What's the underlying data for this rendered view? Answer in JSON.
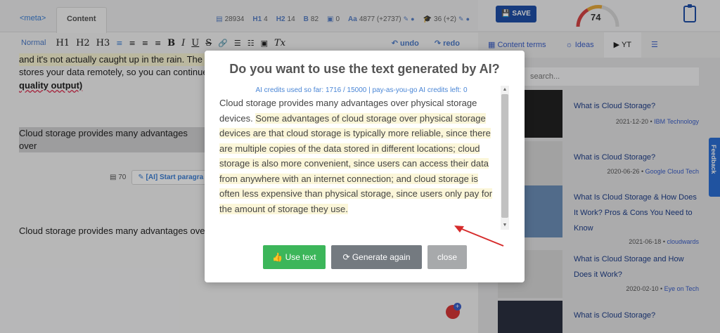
{
  "editor": {
    "tabs": {
      "meta": "<meta>",
      "content": "Content"
    },
    "stats": {
      "words": "28934",
      "h1": "4",
      "h2": "14",
      "bold": "82",
      "images": "0",
      "characters": "4877 (+2737)",
      "readers": "36 (+2)"
    },
    "toolbar": {
      "style": "Normal",
      "h1": "H1",
      "h2": "H2",
      "h3": "H3",
      "undo": "undo",
      "redo": "redo"
    },
    "text": {
      "line1": "and it's not actually caught up in the rain. The v",
      "line2": "stores your data remotely, so you can continue",
      "line3": "quality output)",
      "highlight_line": "Cloud storage provides many advantages over",
      "para_count": "70",
      "ai_button": "[AI] Start paragra",
      "bottom_line": "Cloud storage provides many advantages over"
    }
  },
  "sidebar": {
    "save_label": "SAVE",
    "score": "74",
    "tabs": {
      "content_terms": "Content terms",
      "ideas": "Ideas",
      "yt": "YT"
    },
    "search_placeholder": "search...",
    "videos": [
      {
        "title": "What is Cloud Storage?",
        "date": "2021-12-20",
        "channel": "IBM Technology"
      },
      {
        "title": "What is Cloud Storage?",
        "date": "2020-06-26",
        "channel": "Google Cloud Tech"
      },
      {
        "title": "What Is Cloud Storage & How Does It Work? Pros & Cons You Need to Know",
        "date": "2021-06-18",
        "channel": "cloudwards"
      },
      {
        "title": "What is Cloud Storage and How Does it Work?",
        "date": "2020-02-10",
        "channel": "Eye on Tech"
      },
      {
        "title": "What is Cloud Storage?",
        "date": "",
        "channel": ""
      }
    ],
    "feedback": "Feedback"
  },
  "modal": {
    "title": "Do you want to use the text generated by AI?",
    "credits": "AI credits used so far: 1716 / 15000 | pay-as-you-go AI credits left: 0",
    "original_text": "Cloud storage provides many advantages over physical storage devices.",
    "generated_text": "Some advantages of cloud storage over physical storage devices are that cloud storage is typically more reliable, since there are multiple copies of the data stored in different locations; cloud storage is also more convenient, since users can access their data from anywhere with an internet connection; and cloud storage is often less expensive than physical storage, since users only pay for the amount of storage they use.",
    "use_label": "Use text",
    "generate_label": "Generate again",
    "close_label": "close"
  },
  "colors": {
    "accent": "#3b7fd6",
    "save": "#1f4fa8",
    "use_button": "#3cb65a",
    "generate_button": "#747a80",
    "close_button": "#a7a9ab",
    "arrow": "#d62b2b"
  }
}
